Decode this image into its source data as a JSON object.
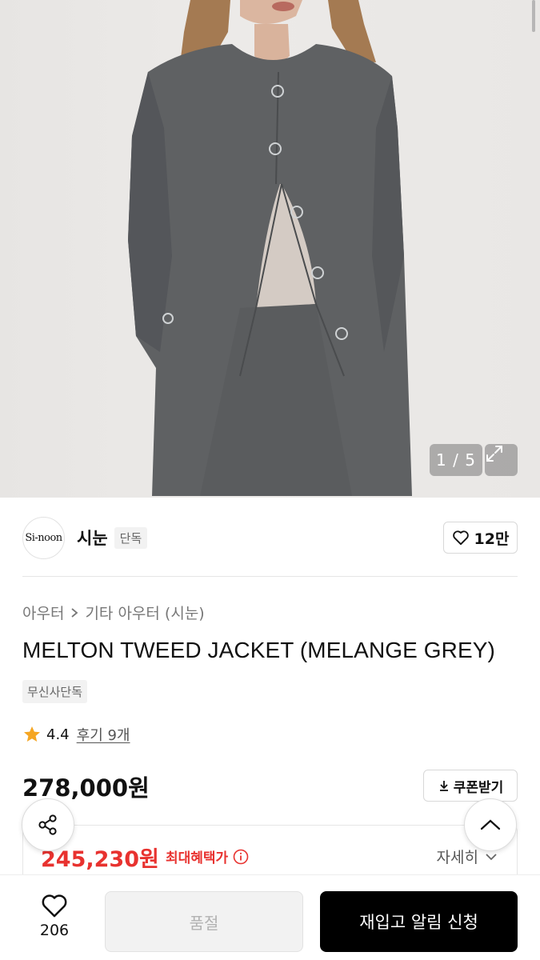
{
  "gallery": {
    "counter": "1 / 5",
    "expand_icon": "expand-icon"
  },
  "brand": {
    "logo_text": "Si-noon",
    "name": "시눈",
    "badge": "단독",
    "like_icon": "heart-icon",
    "like_count": "12만"
  },
  "breadcrumb": {
    "items": [
      "아우터",
      "기타 아우터 (시눈)"
    ]
  },
  "product": {
    "title": "MELTON TWEED JACKET (MELANGE GREY)",
    "tag": "무신사단독",
    "rating": "4.4",
    "review_link": "후기 9개",
    "price": "278,000원",
    "coupon_label": "쿠폰받기"
  },
  "benefit": {
    "price": "245,230원",
    "label": "최대혜택가",
    "detail": "자세히"
  },
  "bottom_bar": {
    "wish_count": "206",
    "soldout_label": "품절",
    "restock_label": "재입고 알림 신청"
  },
  "colors": {
    "accent_red": "#e8322f",
    "primary_button": "#000000",
    "disabled_button": "#f2f2f2"
  }
}
